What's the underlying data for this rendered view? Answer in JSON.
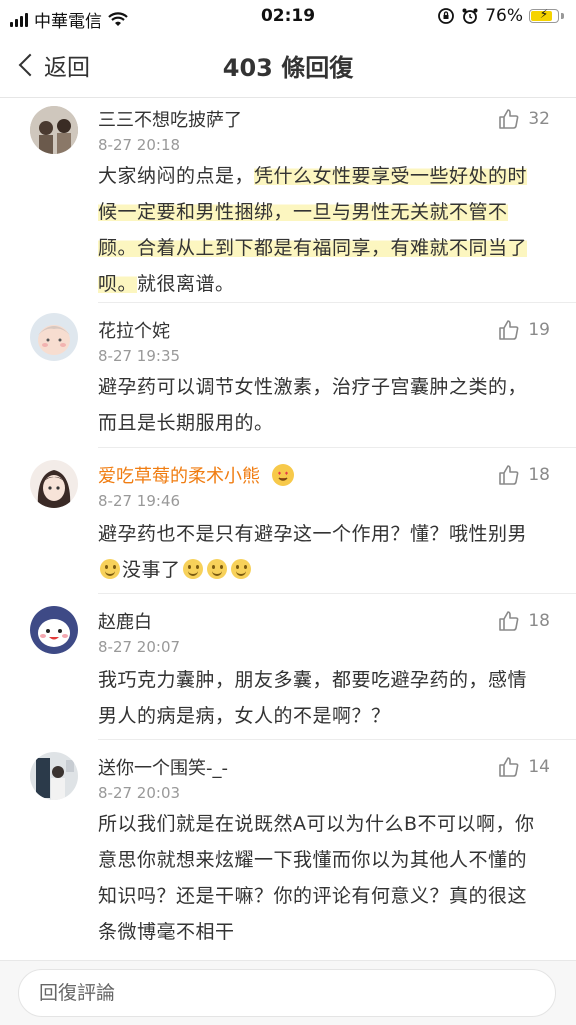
{
  "status_bar": {
    "carrier": "中華電信",
    "time": "02:19",
    "battery": "76%"
  },
  "nav": {
    "back_label": "返回",
    "title": "403 條回復"
  },
  "comments": [
    {
      "name": "三三不想吃披萨了",
      "time": "8-27 20:18",
      "likes": "32",
      "text_plain": "大家纳闷的点是，",
      "text_highlight": "凭什么女性要享受一些好处的时候一定要和男性捆绑，一旦与男性无关就不管不顾。合着从上到下都是有福同享，有难就不同当了呗。",
      "text_tail": "就很离谱。"
    },
    {
      "name": "花拉个姹",
      "time": "8-27 19:35",
      "likes": "19",
      "text": "避孕药可以调节女性激素，治疗子宫囊肿之类的，而且是长期服用的。"
    },
    {
      "name": "爱吃草莓的柔术小熊",
      "time": "8-27 19:46",
      "likes": "18",
      "text_a": "避孕药也不是只有避孕这一个作用？懂？哦性别男",
      "text_b": "没事了"
    },
    {
      "name": "赵鹿白",
      "time": "8-27 20:07",
      "likes": "18",
      "text": "我巧克力囊肿，朋友多囊，都要吃避孕药的，感情男人的病是病，女人的不是啊？？"
    },
    {
      "name": "送你一个围笑-_-",
      "time": "8-27 20:03",
      "likes": "14",
      "text": "所以我们就是在说既然A可以为什么B不可以啊，你意思你就想来炫耀一下我懂而你以为其他人不懂的知识吗？还是干嘛？你的评论有何意义？真的很这条微博毫不相干"
    }
  ],
  "reply_bar": {
    "placeholder": "回復評論"
  },
  "colors": {
    "orange_name": "#f07d12",
    "highlight": "#faf096",
    "muted": "#999999"
  }
}
